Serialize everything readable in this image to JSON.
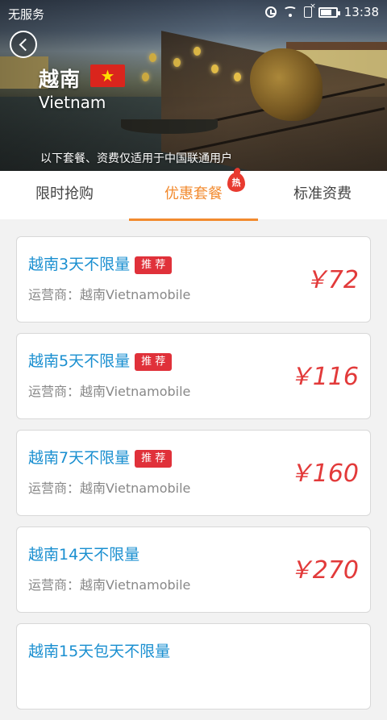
{
  "status_bar": {
    "carrier": "无服务",
    "time": "13:38"
  },
  "header": {
    "country_name": "越南",
    "country_name_en": "Vietnam",
    "flag_star": "★",
    "notice": "以下套餐、资费仅适用于中国联通用户"
  },
  "tabs": [
    {
      "label": "限时抢购",
      "active": false
    },
    {
      "label": "优惠套餐",
      "active": true,
      "badge": "热"
    },
    {
      "label": "标准资费",
      "active": false
    }
  ],
  "packages": [
    {
      "name": "越南3天不限量",
      "badge": "推 荐",
      "operator": "运营商：越南Vietnamobile",
      "price": "￥72"
    },
    {
      "name": "越南5天不限量",
      "badge": "推 荐",
      "operator": "运营商：越南Vietnamobile",
      "price": "￥116"
    },
    {
      "name": "越南7天不限量",
      "badge": "推 荐",
      "operator": "运营商：越南Vietnamobile",
      "price": "￥160"
    },
    {
      "name": "越南14天不限量",
      "badge": "",
      "operator": "运营商：越南Vietnamobile",
      "price": "￥270"
    },
    {
      "name": "越南15天包天不限量",
      "badge": "",
      "operator": "",
      "price": ""
    }
  ],
  "colors": {
    "accent": "#f28a2e",
    "name_blue": "#1a8fd0",
    "price_red": "#e23a3a",
    "badge_red": "#e0313a"
  }
}
